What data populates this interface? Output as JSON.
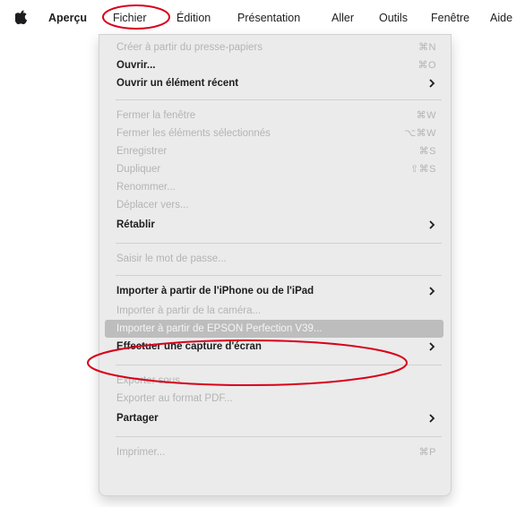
{
  "menubar": {
    "apple_icon": "apple-logo-icon",
    "items": [
      "Aperçu",
      "Fichier",
      "Édition",
      "Présentation",
      "Aller",
      "Outils",
      "Fenêtre",
      "Aide"
    ]
  },
  "annotation_color": "#d9001b",
  "highlight_color": "#bdbdbd",
  "menu": {
    "items": [
      {
        "label": "Créer à partir du presse-papiers",
        "shortcut": "⌘N",
        "enabled": false
      },
      {
        "label": "Ouvrir...",
        "shortcut": "⌘O",
        "enabled": true
      },
      {
        "label": "Ouvrir un élément récent",
        "submenu": true,
        "enabled": true
      },
      {
        "label": "Fermer la fenêtre",
        "shortcut": "⌘W",
        "enabled": false
      },
      {
        "label": "Fermer les éléments sélectionnés",
        "shortcut": "⌥⌘W",
        "enabled": false
      },
      {
        "label": "Enregistrer",
        "shortcut": "⌘S",
        "enabled": false
      },
      {
        "label": "Dupliquer",
        "shortcut": "⇧⌘S",
        "enabled": false
      },
      {
        "label": "Renommer...",
        "enabled": false
      },
      {
        "label": "Déplacer vers...",
        "enabled": false
      },
      {
        "label": "Rétablir",
        "submenu": true,
        "enabled": true
      },
      {
        "label": "Saisir le mot de passe...",
        "enabled": false
      },
      {
        "label": "Importer à partir de l'iPhone ou de l'iPad",
        "submenu": true,
        "enabled": true
      },
      {
        "label": "Importer à partir de la caméra...",
        "enabled": false
      },
      {
        "label": "Importer à partir de EPSON Perfection V39...",
        "enabled": false,
        "highlighted": true
      },
      {
        "label": "Effectuer une capture d'écran",
        "submenu": true,
        "enabled": true
      },
      {
        "label": "Exporter sous...",
        "enabled": false
      },
      {
        "label": "Exporter au format PDF...",
        "enabled": false
      },
      {
        "label": "Partager",
        "submenu": true,
        "enabled": true
      },
      {
        "label": "Imprimer...",
        "shortcut": "⌘P",
        "enabled": false
      }
    ]
  }
}
